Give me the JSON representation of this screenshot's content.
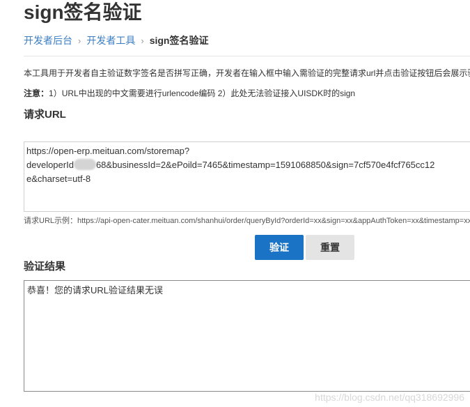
{
  "page": {
    "title": "sign签名验证"
  },
  "breadcrumb": {
    "items": [
      {
        "label": "开发者后台"
      },
      {
        "label": "开发者工具"
      }
    ],
    "separator": "›",
    "current": "sign签名验证"
  },
  "intro": {
    "description": "本工具用于开发者自主验证数字签名是否拼写正确，开发者在输入框中输入需验证的完整请求url并点击验证按钮后会展示验证结果",
    "note_label": "注意：",
    "note_text": "1）URL中出现的中文需要进行urlencode编码 2）此处无法验证接入UISDK时的sign"
  },
  "request": {
    "section_title": "请求URL",
    "line1": "https://open-erp.meituan.com/storemap?",
    "line2_prefix": "developerId",
    "line2_suffix": "68&businessId=2&ePoild=7465&timestamp=1591068850&sign=7cf570e4fcf765cc12",
    "line3": "e&charset=utf-8",
    "example": "请求URL示例：https://api-open-cater.meituan.com/shanhui/order/queryById?orderId=xx&sign=xx&appAuthToken=xx&timestamp=xx"
  },
  "actions": {
    "verify_label": "验证",
    "reset_label": "重置"
  },
  "result": {
    "section_title": "验证结果",
    "text": "恭喜！您的请求URL验证结果无误"
  },
  "watermark": "https://blog.csdn.net/qq318692996"
}
